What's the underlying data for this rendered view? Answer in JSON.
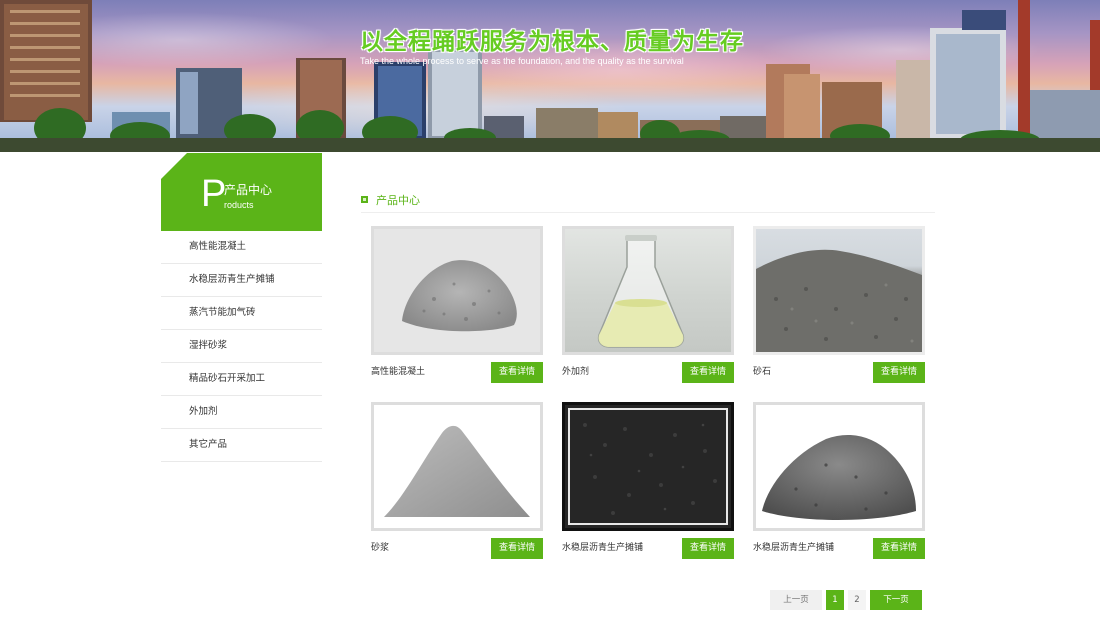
{
  "banner": {
    "title": "以全程踊跃服务为根本、质量为生存",
    "subtitle": "Take the whole process to serve as the foundation, and the quality as the survival"
  },
  "sidebar": {
    "letter": "P",
    "title": "产品中心",
    "subtitle": "roducts",
    "items": [
      {
        "label": "高性能混凝土"
      },
      {
        "label": "水稳层沥青生产摊铺"
      },
      {
        "label": "蒸汽节能加气砖"
      },
      {
        "label": "湿拌砂浆"
      },
      {
        "label": "精品砂石开采加工"
      },
      {
        "label": "外加剂"
      },
      {
        "label": "其它产品"
      }
    ]
  },
  "main": {
    "title": "产品中心",
    "products": [
      {
        "name": "高性能混凝土",
        "button": "查看详情",
        "image": "grey-concrete-powder-pile"
      },
      {
        "name": "外加剂",
        "button": "查看详情",
        "image": "liquid-flask"
      },
      {
        "name": "砂石",
        "button": "查看详情",
        "image": "gravel-pile"
      },
      {
        "name": "砂浆",
        "button": "查看详情",
        "image": "mortar-powder-pile"
      },
      {
        "name": "水稳层沥青生产摊铺",
        "button": "查看详情",
        "image": "asphalt-texture"
      },
      {
        "name": "水稳层沥青生产摊铺",
        "button": "查看详情",
        "image": "dark-grit-pile"
      }
    ]
  },
  "pagination": {
    "prev": "上一页",
    "pages": [
      "1",
      "2"
    ],
    "current": "1",
    "next": "下一页"
  },
  "colors": {
    "accent": "#5bb418",
    "banner_title": "#66cc22",
    "divider": "#e9e9e9"
  }
}
